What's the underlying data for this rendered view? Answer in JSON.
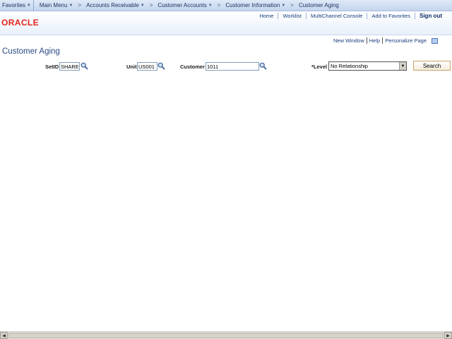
{
  "nav": {
    "favorites": "Favorites",
    "main_menu": "Main Menu",
    "breadcrumbs": [
      "Accounts Receivable",
      "Customer Accounts",
      "Customer Information",
      "Customer Aging"
    ]
  },
  "header": {
    "logo": "ORACLE",
    "links": [
      "Home",
      "Worklist",
      "MultiChannel Console",
      "Add to Favorites"
    ],
    "signout": "Sign out"
  },
  "page_tools": {
    "new_window": "New Window",
    "help": "Help",
    "personalize": "Personalize Page"
  },
  "page_title": "Customer Aging",
  "form": {
    "setid_label": "SetID",
    "setid_value": "SHARE",
    "unit_label": "Unit",
    "unit_value": "US001",
    "customer_label": "Customer",
    "customer_value": "1011",
    "level_label": "*Level",
    "level_value": "No Relationship",
    "search_label": "Search"
  },
  "colors": {
    "brand": "#e2231a",
    "link": "#1b3f7c",
    "title": "#2b4a84"
  }
}
